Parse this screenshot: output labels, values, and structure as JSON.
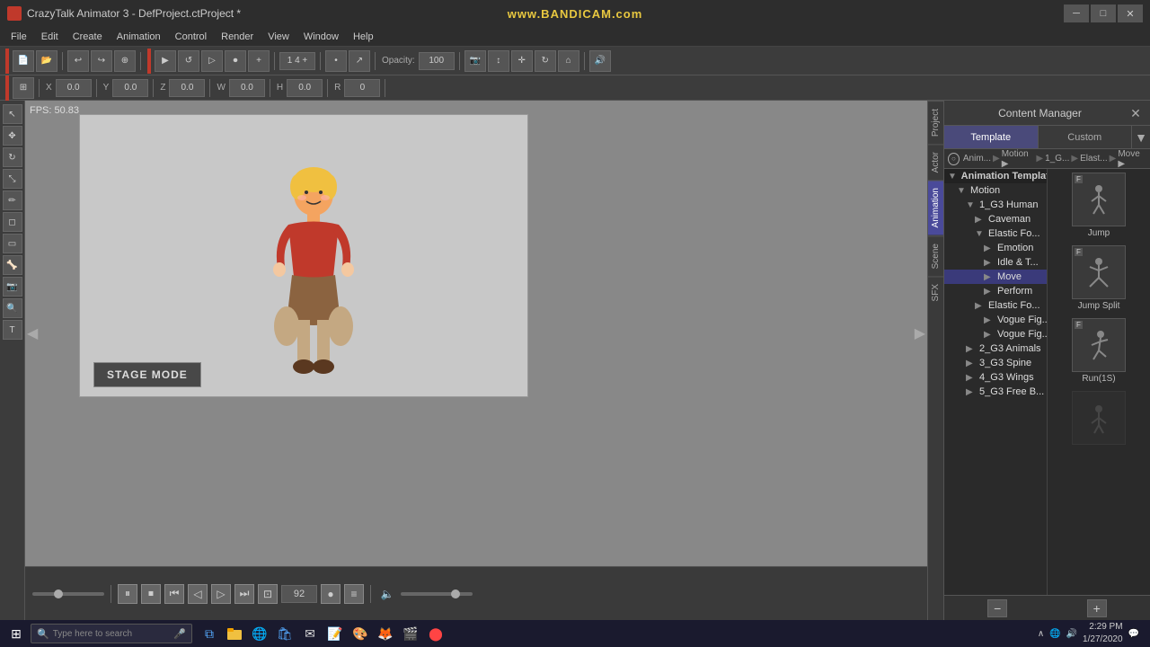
{
  "titlebar": {
    "title": "CrazyTalk Animator 3 - DefProject.ctProject *",
    "watermark": "www.BANDICAM.com",
    "minimize": "─",
    "restore": "□",
    "close": "✕"
  },
  "menubar": {
    "items": [
      "File",
      "Edit",
      "Create",
      "Animation",
      "Control",
      "Render",
      "View",
      "Window",
      "Help"
    ]
  },
  "toolbar1": {
    "opacity_label": "Opacity:",
    "opacity_value": "100"
  },
  "toolbar2": {
    "x_label": "X",
    "x_value": "0.0",
    "y_label": "Y",
    "y_value": "0.0",
    "z_label": "Z",
    "z_value": "0.0",
    "w_label": "W",
    "w_value": "0.0",
    "h_label": "H",
    "h_value": "0.0",
    "r_label": "R",
    "r_value": "0"
  },
  "canvas": {
    "fps": "FPS: 50.83",
    "stage_mode": "STAGE MODE"
  },
  "timeline": {
    "frame_value": "92"
  },
  "content_manager": {
    "title": "Content Manager",
    "tabs": [
      "Template",
      "Custom"
    ],
    "breadcrumb": [
      "Anim...",
      "Motion ▶",
      "1_G...",
      "Elast...",
      "Move ▶"
    ]
  },
  "tree": {
    "items": [
      {
        "label": "Animation Template",
        "level": 0,
        "expanded": true
      },
      {
        "label": "Motion",
        "level": 1,
        "expanded": true
      },
      {
        "label": "1_G3 Human",
        "level": 2,
        "expanded": true
      },
      {
        "label": "Caveman",
        "level": 3,
        "expanded": false
      },
      {
        "label": "Elastic Fo...",
        "level": 3,
        "expanded": true
      },
      {
        "label": "Emotion",
        "level": 4,
        "expanded": false
      },
      {
        "label": "Idle & T...",
        "level": 4,
        "expanded": false
      },
      {
        "label": "Move",
        "level": 4,
        "expanded": false,
        "selected": true
      },
      {
        "label": "Perform",
        "level": 4,
        "expanded": false
      },
      {
        "label": "Elastic Fo...",
        "level": 3,
        "expanded": false
      },
      {
        "label": "Vogue Fig...",
        "level": 4,
        "expanded": false
      },
      {
        "label": "Vogue Fig...",
        "level": 4,
        "expanded": false
      },
      {
        "label": "2_G3 Animals",
        "level": 2,
        "expanded": false
      },
      {
        "label": "3_G3 Spine",
        "level": 2,
        "expanded": false
      },
      {
        "label": "4_G3 Wings",
        "level": 2,
        "expanded": false
      },
      {
        "label": "5_G3 Free B...",
        "level": 2,
        "expanded": false
      }
    ]
  },
  "previews": [
    {
      "label": "Jump",
      "has_f": true
    },
    {
      "label": "Jump Split",
      "has_f": true
    },
    {
      "label": "Run(1S)",
      "has_f": true
    }
  ],
  "side_tabs": [
    "Project",
    "Actor",
    "Animation",
    "Scene",
    "SFX"
  ],
  "taskbar": {
    "search_placeholder": "Type here to search",
    "time": "2:29 PM",
    "date": "1/27/2020"
  }
}
